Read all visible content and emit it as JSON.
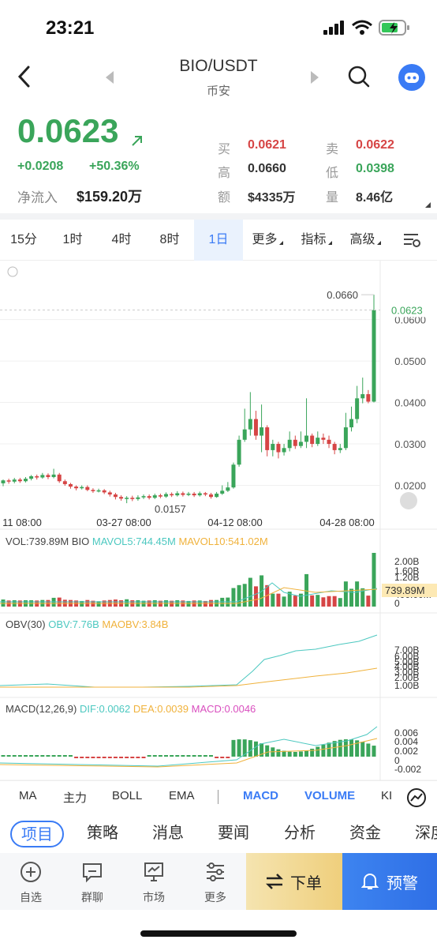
{
  "status": {
    "time": "23:21"
  },
  "header": {
    "pair": "BIO/USDT",
    "exchange": "币安"
  },
  "price": {
    "last": "0.0623",
    "change_abs": "+0.0208",
    "change_pct": "+50.36%",
    "inflow_label": "净流入",
    "inflow_value": "$159.20万"
  },
  "stats": {
    "buy_label": "买",
    "buy_value": "0.0621",
    "sell_label": "卖",
    "sell_value": "0.0622",
    "high_label": "高",
    "high_value": "0.0660",
    "low_label": "低",
    "low_value": "0.0398",
    "amount_label": "额",
    "amount_value": "$4335万",
    "volume_label": "量",
    "volume_value": "8.46亿"
  },
  "timeframes": [
    "15分",
    "1时",
    "4时",
    "8时",
    "1日",
    "更多",
    "指标",
    "高级"
  ],
  "active_timeframe": "1日",
  "chart_data": {
    "type": "candlestick",
    "y_ticks": [
      "0.0600",
      "0.0500",
      "0.0400",
      "0.0300",
      "0.0200"
    ],
    "x_ticks": [
      "11 08:00",
      "03-27 08:00",
      "04-12 08:00",
      "04-28 08:00"
    ],
    "high_marker": "0.0660",
    "low_marker": "0.0157",
    "last_price_tag": "0.0623",
    "ylim": [
      0.014,
      0.0685
    ],
    "candles": [
      [
        0.0205,
        0.0212,
        0.0198,
        0.0214
      ],
      [
        0.0212,
        0.0209,
        0.0204,
        0.0216
      ],
      [
        0.0209,
        0.0214,
        0.0205,
        0.0218
      ],
      [
        0.0214,
        0.021,
        0.0206,
        0.0218
      ],
      [
        0.021,
        0.0216,
        0.0207,
        0.022
      ],
      [
        0.0216,
        0.0222,
        0.0212,
        0.0225
      ],
      [
        0.0222,
        0.0219,
        0.0214,
        0.0226
      ],
      [
        0.0219,
        0.0225,
        0.0216,
        0.023
      ],
      [
        0.0225,
        0.022,
        0.0215,
        0.0229
      ],
      [
        0.022,
        0.0226,
        0.0217,
        0.024
      ],
      [
        0.0226,
        0.021,
        0.0206,
        0.023
      ],
      [
        0.021,
        0.0203,
        0.0199,
        0.0214
      ],
      [
        0.0203,
        0.0197,
        0.0192,
        0.0206
      ],
      [
        0.0197,
        0.0193,
        0.0188,
        0.02
      ],
      [
        0.0193,
        0.0196,
        0.019,
        0.02
      ],
      [
        0.0196,
        0.0189,
        0.0186,
        0.02
      ],
      [
        0.0189,
        0.0186,
        0.0182,
        0.0193
      ],
      [
        0.0186,
        0.0188,
        0.0183,
        0.0192
      ],
      [
        0.0188,
        0.0183,
        0.0179,
        0.0191
      ],
      [
        0.0183,
        0.0178,
        0.0173,
        0.0187
      ],
      [
        0.0178,
        0.0172,
        0.0166,
        0.0182
      ],
      [
        0.0172,
        0.0168,
        0.0163,
        0.0176
      ],
      [
        0.0168,
        0.017,
        0.0157,
        0.0174
      ],
      [
        0.017,
        0.0167,
        0.0162,
        0.0175
      ],
      [
        0.0167,
        0.0171,
        0.0163,
        0.0176
      ],
      [
        0.0171,
        0.0174,
        0.0167,
        0.0178
      ],
      [
        0.0174,
        0.017,
        0.0166,
        0.0178
      ],
      [
        0.017,
        0.0176,
        0.0167,
        0.018
      ],
      [
        0.0176,
        0.0173,
        0.0169,
        0.018
      ],
      [
        0.0173,
        0.0179,
        0.017,
        0.0183
      ],
      [
        0.0179,
        0.0176,
        0.0172,
        0.0183
      ],
      [
        0.0176,
        0.0181,
        0.0173,
        0.0186
      ],
      [
        0.0181,
        0.0177,
        0.0173,
        0.0185
      ],
      [
        0.0177,
        0.018,
        0.0174,
        0.0184
      ],
      [
        0.018,
        0.0176,
        0.0172,
        0.0184
      ],
      [
        0.0176,
        0.0181,
        0.0173,
        0.0185
      ],
      [
        0.0181,
        0.0178,
        0.0174,
        0.0184
      ],
      [
        0.0178,
        0.0172,
        0.0168,
        0.0182
      ],
      [
        0.0172,
        0.018,
        0.017,
        0.0184
      ],
      [
        0.018,
        0.0187,
        0.0177,
        0.02
      ],
      [
        0.0187,
        0.0195,
        0.0184,
        0.0208
      ],
      [
        0.0195,
        0.025,
        0.0192,
        0.0255
      ],
      [
        0.025,
        0.031,
        0.0245,
        0.032
      ],
      [
        0.031,
        0.0335,
        0.0305,
        0.0385
      ],
      [
        0.0335,
        0.036,
        0.032,
        0.0425
      ],
      [
        0.036,
        0.032,
        0.031,
        0.038
      ],
      [
        0.032,
        0.034,
        0.028,
        0.0395
      ],
      [
        0.034,
        0.0285,
        0.027,
        0.0345
      ],
      [
        0.0285,
        0.03,
        0.027,
        0.031
      ],
      [
        0.03,
        0.028,
        0.0265,
        0.0305
      ],
      [
        0.028,
        0.029,
        0.0272,
        0.03
      ],
      [
        0.029,
        0.031,
        0.0282,
        0.033
      ],
      [
        0.031,
        0.0295,
        0.0288,
        0.032
      ],
      [
        0.0295,
        0.0305,
        0.029,
        0.033
      ],
      [
        0.0305,
        0.032,
        0.029,
        0.041
      ],
      [
        0.032,
        0.03,
        0.0292,
        0.0325
      ],
      [
        0.03,
        0.0315,
        0.0295,
        0.033
      ],
      [
        0.0315,
        0.031,
        0.03,
        0.0325
      ],
      [
        0.031,
        0.03,
        0.029,
        0.032
      ],
      [
        0.03,
        0.0285,
        0.0275,
        0.0305
      ],
      [
        0.0285,
        0.029,
        0.0278,
        0.03
      ],
      [
        0.029,
        0.034,
        0.0285,
        0.0375
      ],
      [
        0.034,
        0.036,
        0.033,
        0.039
      ],
      [
        0.036,
        0.041,
        0.035,
        0.044
      ],
      [
        0.041,
        0.042,
        0.0398,
        0.046
      ],
      [
        0.042,
        0.0402,
        0.0398,
        0.043
      ],
      [
        0.0402,
        0.0623,
        0.04,
        0.066
      ]
    ],
    "vol_legend": {
      "vol": "VOL:739.89M BIO",
      "ma5": "MAVOL5:744.45M",
      "ma10": "MAVOL10:541.02M"
    },
    "vol_ticks": [
      "2.00B",
      "1.60B",
      "1.20B",
      "400.00M",
      "0"
    ],
    "vol_tag": "739.89M",
    "obv_legend": {
      "obv": "OBV(30)",
      "obv_val": "OBV:7.76B",
      "maobv": "MAOBV:3.84B"
    },
    "obv_ticks": [
      "7.00B",
      "6.00B",
      "5.00B",
      "4.00B",
      "3.00B",
      "2.00B",
      "1.00B"
    ],
    "macd_legend": {
      "name": "MACD(12,26,9)",
      "dif": "DIF:0.0062",
      "dea": "DEA:0.0039",
      "macd": "MACD:0.0046"
    },
    "macd_ticks": [
      "0.006",
      "0.004",
      "0.002",
      "0",
      "-0.002"
    ]
  },
  "indicators": [
    "MA",
    "主力",
    "BOLL",
    "EMA",
    "MACD",
    "VOLUME",
    "KI"
  ],
  "active_indicators": [
    "MACD",
    "VOLUME"
  ],
  "tabs": [
    "项目",
    "策略",
    "消息",
    "要闻",
    "分析",
    "资金",
    "深度"
  ],
  "active_tab": "项目",
  "bottom_nav": [
    "自选",
    "群聊",
    "市场",
    "更多"
  ],
  "order_label": "下单",
  "alert_label": "预警",
  "colors": {
    "up": "#3aa55a",
    "down": "#d64545",
    "accent": "#3a7bf5",
    "ma5": "#4cc8c0",
    "ma10": "#f0b23c",
    "macd": "#d94fbf"
  }
}
